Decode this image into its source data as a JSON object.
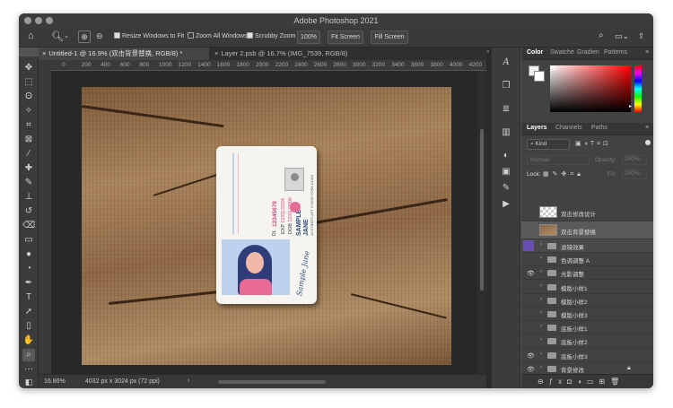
{
  "window": {
    "title": "Adobe Photoshop 2021"
  },
  "options_bar": {
    "resize_windows": "Resize Windows to Fit",
    "zoom_all": "Zoom All Windows",
    "scrubby": "Scrubby Zoom",
    "zoom_value": "100%",
    "fit_screen": "Fit Screen",
    "fill_screen": "Fill Screen"
  },
  "tabs": [
    {
      "label": "Untitled-1 @ 16.9% (双击背景替换, RGB/8) *"
    },
    {
      "label": "Layer 2.psb @ 16.7% (IMG_7539, RGB/8)"
    }
  ],
  "ruler": {
    "ticks": [
      "0",
      "200",
      "400",
      "600",
      "800",
      "1000",
      "1200",
      "1400",
      "1600",
      "1800",
      "2000",
      "2200",
      "2400",
      "2600",
      "2800",
      "3000",
      "3200",
      "3400",
      "3600",
      "3800",
      "4000",
      "4200"
    ]
  },
  "card": {
    "number": "12345678",
    "exp_label": "EXP",
    "exp": "12/01/2024",
    "dob_label": "DOB",
    "dob": "12/01/2000",
    "dl_label": "DL",
    "name1": "SAMPLE",
    "name2": "JANE",
    "address": "10 STREET APT 5 NEW YORK 01010",
    "signature": "Sample Jane"
  },
  "status": {
    "zoom": "16.86%",
    "dimensions": "4032 px x 3024 px (72 ppi)"
  },
  "color_panel": {
    "tabs": [
      "Color",
      "Swatche",
      "Gradien",
      "Patterns"
    ]
  },
  "layers_panel": {
    "tabs": [
      "Layers",
      "Channels",
      "Paths"
    ],
    "kind": "Kind",
    "blend": "Normal",
    "opacity_label": "Opacity:",
    "opacity": "100%",
    "lock_label": "Lock:",
    "fill_label": "Fill:",
    "fill": "100%",
    "layers": [
      {
        "name": "双击修改设计",
        "visible": false,
        "type": "smart"
      },
      {
        "name": "双击背景替换",
        "visible": false,
        "type": "smart"
      },
      {
        "name": "滤镜效果",
        "visible": false,
        "type": "group"
      },
      {
        "name": "色调调整 A",
        "visible": false,
        "type": "group"
      },
      {
        "name": "光影调整",
        "visible": true,
        "type": "group"
      },
      {
        "name": "模版小样1",
        "visible": false,
        "type": "group"
      },
      {
        "name": "模版小样2",
        "visible": false,
        "type": "group"
      },
      {
        "name": "模版小样3",
        "visible": false,
        "type": "group"
      },
      {
        "name": "底板小样1",
        "visible": false,
        "type": "group"
      },
      {
        "name": "底板小样2",
        "visible": false,
        "type": "group"
      },
      {
        "name": "底板小样3",
        "visible": true,
        "type": "group"
      },
      {
        "name": "背景修改",
        "visible": true,
        "type": "group"
      }
    ]
  }
}
